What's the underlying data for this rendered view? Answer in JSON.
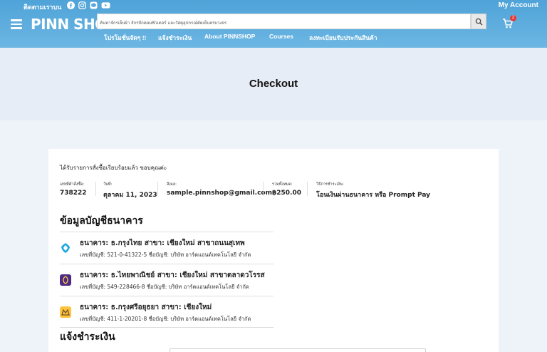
{
  "header": {
    "follow_text": "ติดตามเราบน",
    "my_account": "My Account",
    "logo": "PINN SHOP",
    "search_placeholder": "ค้นหาจักรเย็บผ้า จักรปักคอมพิวเตอร์ และวัสดุอุปกรณ์ตัดเย็บครบวงจร",
    "cart_count": "2",
    "nav": [
      "โปรโมชั่นจัดๆ !!",
      "แจ้งชำระเงิน",
      "About PINNSHOP",
      "Courses",
      "ลงทะเบียนรับประกันสินค้า"
    ]
  },
  "page": {
    "title": "Checkout"
  },
  "order": {
    "thanks": "ได้รับรายการสั่งซื้อเรียบร้อยแล้ว ขอบคุณค่ะ",
    "summary": [
      {
        "label": "เลขที่คำสั่งซื้อ:",
        "value": "738222"
      },
      {
        "label": "วันที่:",
        "value": "ตุลาคม 11, 2023"
      },
      {
        "label": "อีเมล:",
        "value": "sample.pinnshop@gmail.com"
      },
      {
        "label": "รวมทั้งหมด:",
        "value": "฿250.00"
      },
      {
        "label": "วิธีการชำระเงิน:",
        "value": "โอนเงินผ่านธนาคาร หรือ Prompt Pay"
      }
    ]
  },
  "bank_section": {
    "title": "ข้อมูลบัญชีธนาคาร",
    "banks": [
      {
        "name": "ธนาคาร: ธ.กรุงไทย  สาขา: เชียงใหม่ สาขาถนนสุเทพ",
        "account": "เลขที่บัญชี: 521-0-41322-5   ชื่อบัญชี: บริษัท อาร์ตแอนด์เทคโนโลยี จำกัด",
        "icon": "krungthai-logo-icon",
        "color": "#1ba5e1"
      },
      {
        "name": "ธนาคาร: ธ.ไทยพาณิชย์  สาขา: เชียงใหม่ สาขาตลาดวโรรส",
        "account": "เลขที่บัญชี: 549-228466-8   ชื่อบัญชี: บริษัท อาร์ตแอนด์เทคโนโลยี จำกัด",
        "icon": "scb-logo-icon",
        "color": "#4e2a84"
      },
      {
        "name": "ธนาคาร: ธ.กรุงศรีอยุธยา  สาขา: เชียงใหม่",
        "account": "เลขที่บัญชี: 411-1-20201-8   ชื่อบัญชี: บริษัท อาร์ตแอนด์เทคโนโลยี จำกัด",
        "icon": "krungsri-logo-icon",
        "color": "#fec43b"
      }
    ]
  },
  "payment_notify": {
    "title": "แจ้งชำระเงิน"
  }
}
